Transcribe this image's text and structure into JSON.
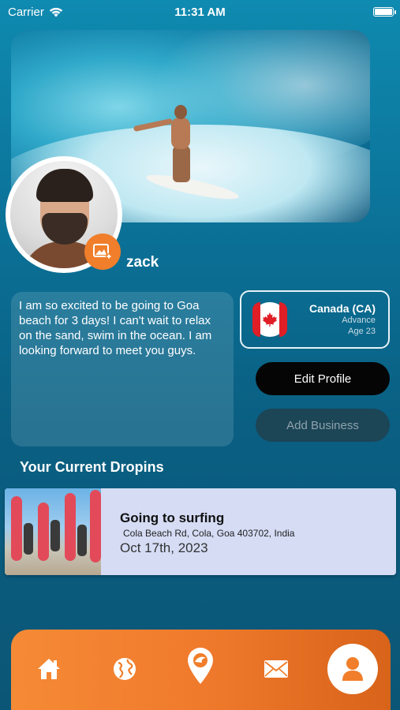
{
  "status_bar": {
    "carrier": "Carrier",
    "time": "11:31 AM"
  },
  "profile": {
    "username": "zack",
    "bio": "I am so excited to be going to Goa beach for 3 days! I can't wait to relax on the sand, swim in the ocean. I am looking forward to meet you guys.",
    "country": "Canada (CA)",
    "level": "Advance",
    "age": "Age 23"
  },
  "actions": {
    "edit_profile": "Edit Profile",
    "add_business": "Add Business"
  },
  "dropins": {
    "section_title": "Your Current Dropins",
    "items": [
      {
        "title": "Going to surfing",
        "address": "Cola Beach Rd, Cola, Goa 403702, India",
        "date": "Oct 17th, 2023"
      }
    ]
  },
  "tabbar": {
    "items": [
      "home-icon",
      "globe-icon",
      "location-pin-icon",
      "mail-icon",
      "profile-icon"
    ],
    "active": "profile-icon"
  },
  "colors": {
    "accent": "#f07e2a",
    "background_top": "#0f8ab0",
    "background_bottom": "#0b5676",
    "card": "#d5dcf4"
  }
}
